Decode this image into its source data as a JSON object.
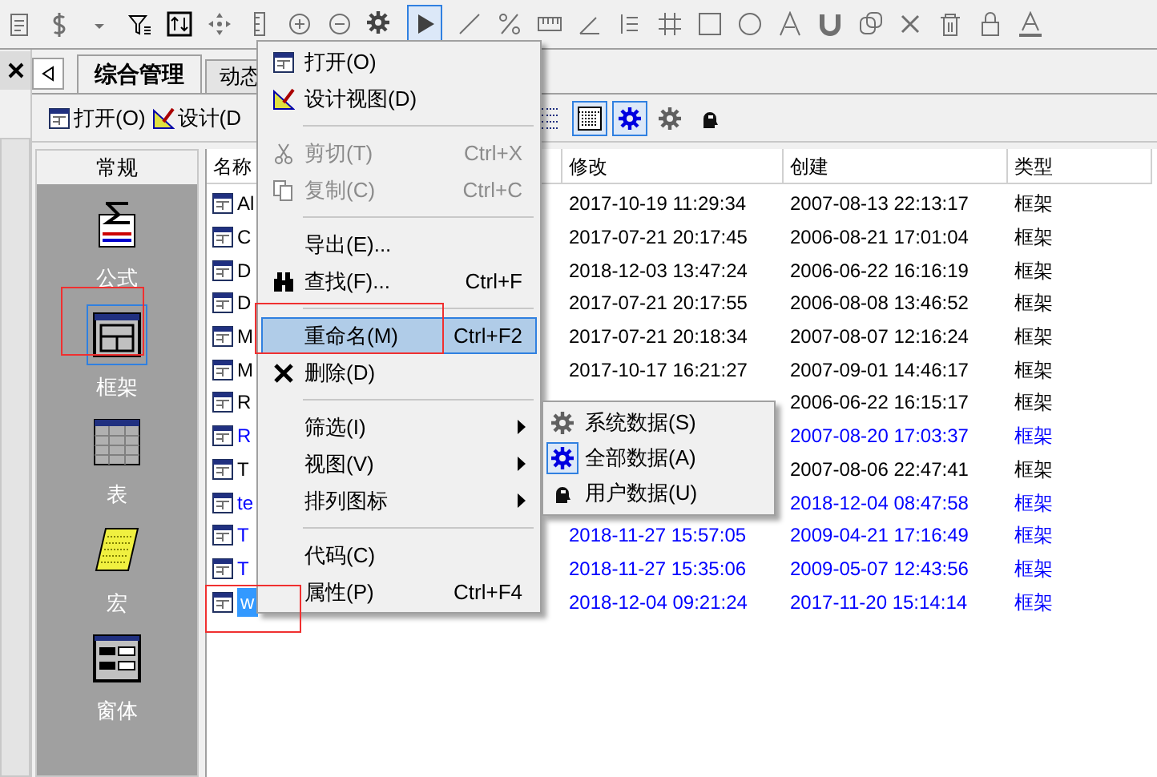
{
  "tabs": [
    {
      "label": "综合管理",
      "selected": true
    },
    {
      "label": "动态",
      "selected": false
    }
  ],
  "object_toolbar": {
    "buttons": [
      {
        "label": "打开(O)"
      },
      {
        "label": "设计(D"
      }
    ],
    "view_buttons": [
      {
        "selected": false
      },
      {
        "selected": true
      }
    ],
    "filter_buttons": [
      {
        "selected": true
      },
      {
        "selected": false
      },
      {
        "selected": false
      }
    ]
  },
  "sidebar": {
    "header": "常规",
    "items": [
      {
        "label": "公式",
        "selected": false
      },
      {
        "label": "框架",
        "selected": true
      },
      {
        "label": "表",
        "selected": false
      },
      {
        "label": "宏",
        "selected": false
      },
      {
        "label": "窗体",
        "selected": false
      }
    ]
  },
  "table": {
    "columns": [
      "名称",
      "修改",
      "创建",
      "类型"
    ],
    "rows": [
      {
        "name": "Al",
        "modified": "2017-10-19 11:29:34",
        "created": "2007-08-13 22:13:17",
        "type": "框架",
        "color": "#000000",
        "selected": false
      },
      {
        "name": "C",
        "modified": "2017-07-21 20:17:45",
        "created": "2006-08-21 17:01:04",
        "type": "框架",
        "color": "#000000",
        "selected": false
      },
      {
        "name": "D",
        "modified": "2018-12-03 13:47:24",
        "created": "2006-06-22 16:16:19",
        "type": "框架",
        "color": "#000000",
        "selected": false
      },
      {
        "name": "D",
        "modified": "2017-07-21 20:17:55",
        "created": "2006-08-08 13:46:52",
        "type": "框架",
        "color": "#000000",
        "selected": false
      },
      {
        "name": "M",
        "modified": "2017-07-21 20:18:34",
        "created": "2007-08-07 12:16:24",
        "type": "框架",
        "color": "#000000",
        "selected": false
      },
      {
        "name": "M",
        "modified": "2017-10-17 16:21:27",
        "created": "2007-09-01 14:46:17",
        "type": "框架",
        "color": "#000000",
        "selected": false
      },
      {
        "name": "R",
        "created": "2006-06-22 16:15:17",
        "type": "框架",
        "color": "#000000",
        "selected": false
      },
      {
        "name": "R",
        "created": "2007-08-20 17:03:37",
        "type": "框架",
        "color": "#0000ff",
        "selected": false
      },
      {
        "name": "T",
        "created": "2007-08-06 22:47:41",
        "type": "框架",
        "color": "#000000",
        "selected": false
      },
      {
        "name": "te",
        "created": "2018-12-04 08:47:58",
        "type": "框架",
        "color": "#0000ff",
        "selected": false
      },
      {
        "name": "T",
        "modified": "2018-11-27 15:57:05",
        "created": "2009-04-21 17:16:49",
        "type": "框架",
        "color": "#0000ff",
        "selected": false
      },
      {
        "name": "T",
        "modified": "2018-11-27 15:35:06",
        "created": "2009-05-07 12:43:56",
        "type": "框架",
        "color": "#0000ff",
        "selected": false
      },
      {
        "name": "w",
        "modified": "2018-12-04 09:21:24",
        "created": "2017-11-20 15:14:14",
        "type": "框架",
        "color": "#0000ff",
        "selected": true
      }
    ]
  },
  "context_menu": {
    "items": [
      {
        "kind": "item",
        "label": "打开(O)",
        "disabled": false,
        "selected": false
      },
      {
        "kind": "item",
        "label": "设计视图(D)",
        "disabled": false,
        "selected": false
      },
      {
        "kind": "separator"
      },
      {
        "kind": "item",
        "label": "剪切(T)",
        "shortcut": "Ctrl+X",
        "disabled": true,
        "selected": false
      },
      {
        "kind": "item",
        "label": "复制(C)",
        "shortcut": "Ctrl+C",
        "disabled": true,
        "selected": false
      },
      {
        "kind": "separator"
      },
      {
        "kind": "item",
        "label": "导出(E)...",
        "disabled": false,
        "selected": false
      },
      {
        "kind": "item",
        "label": "查找(F)...",
        "shortcut": "Ctrl+F",
        "disabled": false,
        "selected": false
      },
      {
        "kind": "separator"
      },
      {
        "kind": "item",
        "label": "重命名(M)",
        "shortcut": "Ctrl+F2",
        "disabled": false,
        "selected": true
      },
      {
        "kind": "item",
        "label": "删除(D)",
        "disabled": false,
        "selected": false
      },
      {
        "kind": "separator"
      },
      {
        "kind": "submenu",
        "label": "筛选(I)",
        "disabled": false,
        "selected": false
      },
      {
        "kind": "submenu",
        "label": "视图(V)",
        "disabled": false,
        "selected": false
      },
      {
        "kind": "submenu",
        "label": "排列图标",
        "disabled": false,
        "selected": false
      },
      {
        "kind": "separator"
      },
      {
        "kind": "item",
        "label": "代码(C)",
        "disabled": false,
        "selected": false
      },
      {
        "kind": "item",
        "label": "属性(P)",
        "shortcut": "Ctrl+F4",
        "disabled": false,
        "selected": false
      }
    ]
  },
  "submenu": {
    "items": [
      {
        "label": "系统数据(S)",
        "checked": false
      },
      {
        "label": "全部数据(A)",
        "checked": true
      },
      {
        "label": "用户数据(U)",
        "checked": false
      }
    ]
  }
}
